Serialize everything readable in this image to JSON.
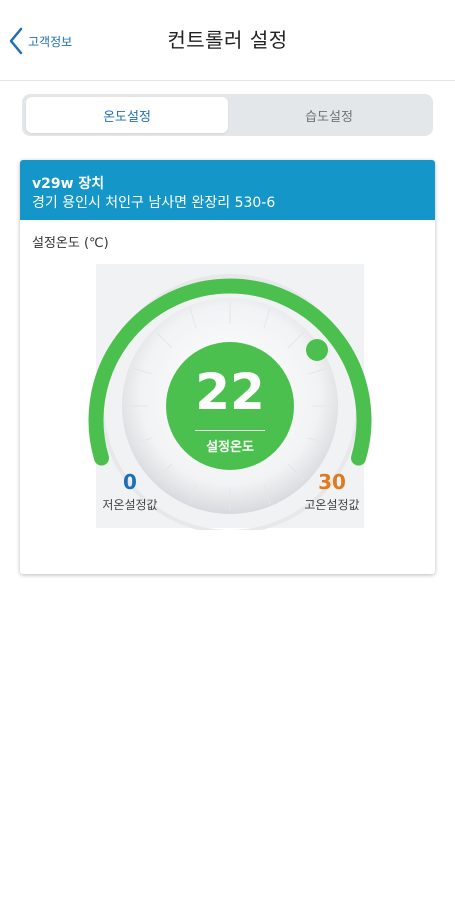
{
  "header": {
    "back_label": "고객정보",
    "title": "컨트롤러 설정"
  },
  "tabs": [
    {
      "label": "온도설정",
      "active": true
    },
    {
      "label": "습도설정",
      "active": false
    }
  ],
  "device": {
    "name": "v29w 장치",
    "address": "경기 용인시 처인구 남사면 완장리 530-6"
  },
  "thermostat": {
    "section_label": "설정온도 (℃)",
    "set_value": "22",
    "set_label": "설정온도",
    "min_value": "0",
    "min_label": "저온설정값",
    "max_value": "30",
    "max_label": "고온설정값"
  },
  "colors": {
    "accent_blue": "#1497c8",
    "link_blue": "#1d6fb8",
    "dial_green": "#4cc04f",
    "max_orange": "#e07a1f"
  },
  "icons": [
    "chevron-left-icon",
    "dial-knob-icon"
  ]
}
